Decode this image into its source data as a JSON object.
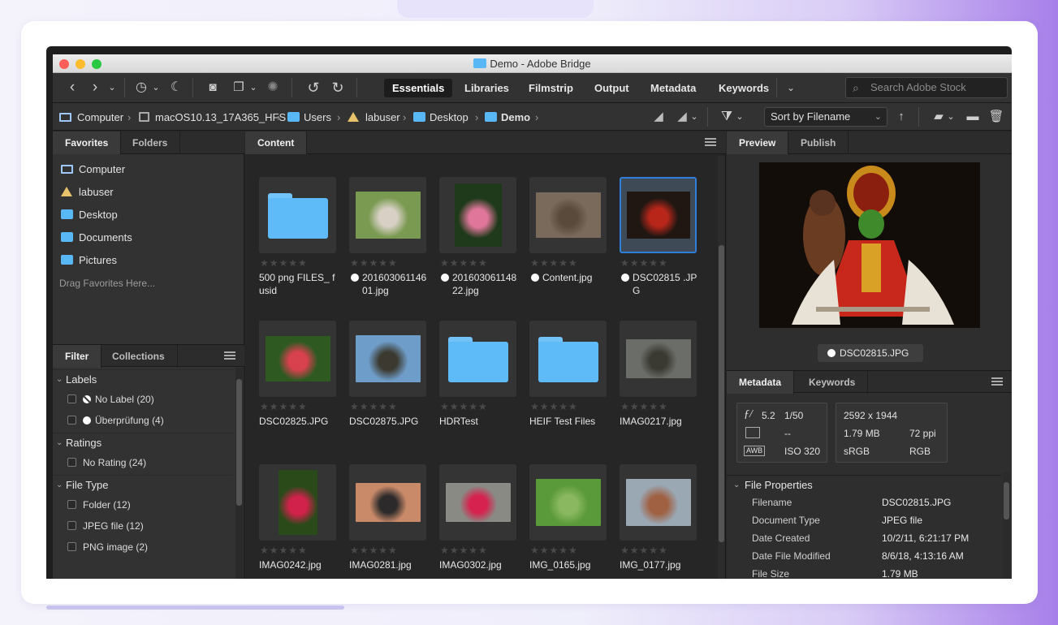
{
  "window": {
    "title": "Demo - Adobe Bridge"
  },
  "toolbar": {
    "workspaces": [
      {
        "label": "Essentials",
        "active": true
      },
      {
        "label": "Libraries"
      },
      {
        "label": "Filmstrip"
      },
      {
        "label": "Output"
      },
      {
        "label": "Metadata"
      },
      {
        "label": "Keywords"
      }
    ],
    "search_placeholder": "Search Adobe Stock"
  },
  "breadcrumb": [
    {
      "label": "Computer",
      "icon": "monitor-icon"
    },
    {
      "label": "macOS10.13_17A365_HFS",
      "icon": "disk-icon"
    },
    {
      "label": "Users",
      "icon": "folder-icon"
    },
    {
      "label": "labuser",
      "icon": "home-icon"
    },
    {
      "label": "Desktop",
      "icon": "folder-icon"
    },
    {
      "label": "Demo",
      "icon": "folder-icon",
      "current": true
    }
  ],
  "sort": {
    "label": "Sort by Filename"
  },
  "favorites_panel": {
    "tabs": [
      "Favorites",
      "Folders"
    ],
    "items": [
      "Computer",
      "labuser",
      "Desktop",
      "Documents",
      "Pictures"
    ],
    "drag_hint": "Drag Favorites Here..."
  },
  "filter_panel": {
    "tabs": [
      "Filter",
      "Collections"
    ],
    "sections": [
      {
        "title": "Labels",
        "rows": [
          {
            "label": "No Label",
            "count": "(20)"
          },
          {
            "label": "Überprüfung",
            "count": "(4)"
          }
        ]
      },
      {
        "title": "Ratings",
        "rows": [
          {
            "label": "No Rating",
            "count": "(24)"
          }
        ]
      },
      {
        "title": "File Type",
        "rows": [
          {
            "label": "Folder",
            "count": "(12)"
          },
          {
            "label": "JPEG file",
            "count": "(12)"
          },
          {
            "label": "PNG image",
            "count": "(2)"
          }
        ]
      }
    ]
  },
  "content_panel": {
    "tab": "Content",
    "items": [
      {
        "name": "500 png FILES_ fusid",
        "type": "folder"
      },
      {
        "name": "20160306114601.jpg",
        "type": "image",
        "label_dot": true
      },
      {
        "name": "20160306114822.jpg",
        "type": "image",
        "label_dot": true
      },
      {
        "name": "Content.jpg",
        "type": "image",
        "label_dot": true
      },
      {
        "name": "DSC02815 .JPG",
        "type": "image",
        "label_dot": true,
        "selected": true
      },
      {
        "name": "DSC02825.JPG",
        "type": "image"
      },
      {
        "name": "DSC02875.JPG",
        "type": "image"
      },
      {
        "name": "HDRTest",
        "type": "folder"
      },
      {
        "name": "HEIF Test Files",
        "type": "folder"
      },
      {
        "name": "IMAG0217.jpg",
        "type": "image"
      },
      {
        "name": "IMAG0242.jpg",
        "type": "image"
      },
      {
        "name": "IMAG0281.jpg",
        "type": "image"
      },
      {
        "name": "IMAG0302.jpg",
        "type": "image"
      },
      {
        "name": "IMG_0165.jpg",
        "type": "image"
      },
      {
        "name": "IMG_0177.jpg",
        "type": "image"
      }
    ]
  },
  "preview_panel": {
    "tabs": [
      "Preview",
      "Publish"
    ],
    "filename": "DSC02815.JPG"
  },
  "metadata_panel": {
    "tabs": [
      "Metadata",
      "Keywords"
    ],
    "exif": {
      "aperture": "5.2",
      "shutter": "1/50",
      "metering": "--",
      "iso": "320",
      "iso_label": "ISO"
    },
    "image": {
      "dimensions": "2592 x 1944",
      "size": "1.79 MB",
      "resolution": "72 ppi",
      "profile": "sRGB",
      "mode": "RGB"
    },
    "section_title": "File Properties",
    "properties": [
      {
        "key": "Filename",
        "value": "DSC02815.JPG"
      },
      {
        "key": "Document Type",
        "value": "JPEG file"
      },
      {
        "key": "Date Created",
        "value": "10/2/11, 6:21:17 PM"
      },
      {
        "key": "Date File Modified",
        "value": "8/6/18, 4:13:16 AM"
      },
      {
        "key": "File Size",
        "value": "1.79 MB"
      }
    ]
  }
}
